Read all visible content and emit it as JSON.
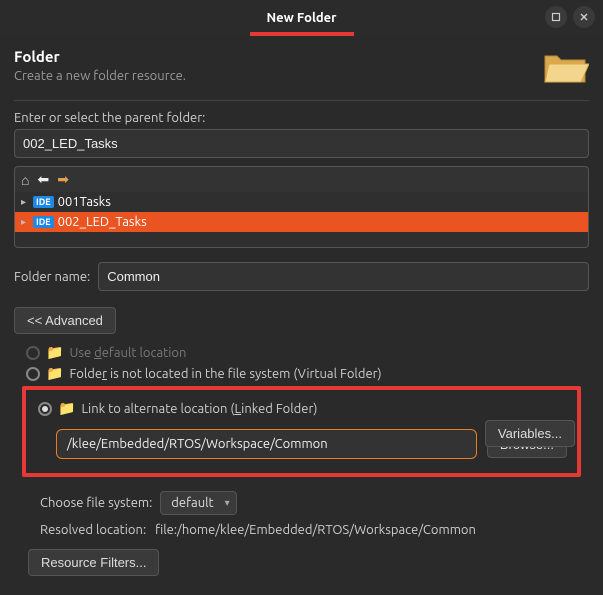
{
  "title": "New Folder",
  "header": {
    "title": "Folder",
    "subtitle": "Create a new folder resource."
  },
  "parent": {
    "label": "Enter or select the parent folder:",
    "value": "002_LED_Tasks"
  },
  "tree": {
    "items": [
      {
        "badge": "IDE",
        "name": "001Tasks",
        "selected": false
      },
      {
        "badge": "IDE",
        "name": "002_LED_Tasks",
        "selected": true
      }
    ]
  },
  "folderName": {
    "label": "Folder name:",
    "value": "Common"
  },
  "advancedButton": "<< Advanced",
  "options": {
    "useDefault": {
      "label_pre": "Use ",
      "label_u": "d",
      "label_post": "efault location"
    },
    "virtual": {
      "label_pre": "Folde",
      "label_u": "r",
      "label_post": " is not located in the file system (Virtual Folder)"
    },
    "linked": {
      "label_pre": "Link to alternate location (",
      "label_u": "L",
      "label_post": "inked Folder)",
      "path": "/klee/Embedded/RTOS/Workspace/Common",
      "browse": "Browse...",
      "variables": "Variables..."
    }
  },
  "chooseFS": {
    "label": "Choose file system:",
    "value": "default"
  },
  "resolved": {
    "label": "Resolved location:",
    "value": "file:/home/klee/Embedded/RTOS/Workspace/Common"
  },
  "filtersButton": "Resource Filters..."
}
